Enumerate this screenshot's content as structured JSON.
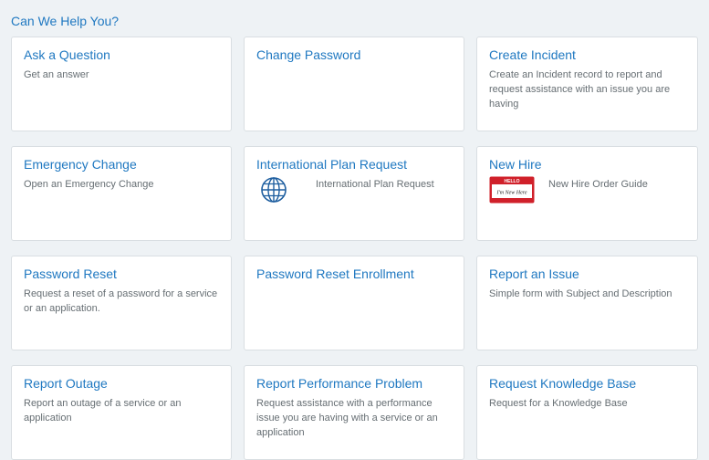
{
  "heading": "Can We Help You?",
  "cards": [
    {
      "title": "Ask a Question",
      "desc": "Get an answer"
    },
    {
      "title": "Change Password",
      "desc": ""
    },
    {
      "title": "Create Incident",
      "desc": "Create an Incident record to report and request assistance with an issue you are having"
    },
    {
      "title": "Emergency Change",
      "desc": "Open an Emergency Change"
    },
    {
      "title": "International Plan Request",
      "desc": "International Plan Request",
      "icon": "globe-icon"
    },
    {
      "title": "New Hire",
      "desc": "New Hire Order Guide",
      "icon": "name-tag-icon",
      "tag_top": "HELLO",
      "tag_name": "I'm New Here"
    },
    {
      "title": "Password Reset",
      "desc": "Request a reset of a password for a service or an application."
    },
    {
      "title": "Password Reset Enrollment",
      "desc": ""
    },
    {
      "title": "Report an Issue",
      "desc": "Simple form with Subject and Description"
    },
    {
      "title": "Report Outage",
      "desc": "Report an outage of a service or an application"
    },
    {
      "title": "Report Performance Problem",
      "desc": "Request assistance with a performance issue you are having with a service or an application"
    },
    {
      "title": "Request Knowledge Base",
      "desc": "Request for a Knowledge Base"
    }
  ],
  "colors": {
    "accent": "#1f78c1",
    "background": "#eef2f5",
    "tag_red": "#d0202a"
  }
}
